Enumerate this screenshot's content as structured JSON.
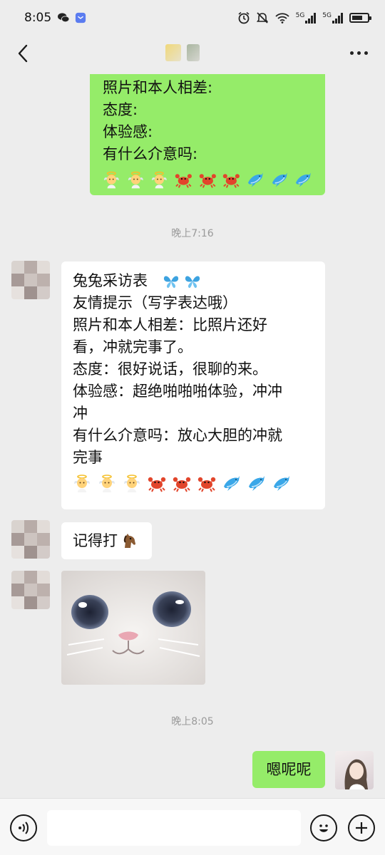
{
  "status_bar": {
    "time": "8:05",
    "signal_labels": [
      "5G",
      "5G"
    ]
  },
  "header": {
    "title_blurred": true
  },
  "messages": {
    "outgoing_top_lines": "照片和本人相差:\n态度:\n体验感:\n有什么介意吗:",
    "time_1": "晚上7:16",
    "incoming_form": "兔兔采访表\n友情提示（写字表达哦）\n照片和本人相差：比照片还好\n看，冲就完事了。\n态度：很好说话，很聊的来。\n体验感：超绝啪啪啪体验，冲冲\n冲\n有什么介意吗：放心大胆的冲就\n完事",
    "incoming_short": "记得打",
    "time_2": "晚上8:05",
    "outgoing_reply": "嗯呢呢"
  },
  "emoji_rows": {
    "top": [
      "baby-angel",
      "baby-angel",
      "baby-angel",
      "crab",
      "crab",
      "crab",
      "dolphin",
      "dolphin",
      "dolphin"
    ],
    "form": [
      "baby-angel",
      "baby-angel",
      "baby-angel",
      "crab",
      "crab",
      "crab",
      "dolphin",
      "dolphin",
      "dolphin"
    ]
  },
  "colors": {
    "bubble_green": "#95ec69",
    "bubble_white": "#ffffff",
    "background": "#ededed"
  },
  "input": {
    "placeholder": ""
  }
}
